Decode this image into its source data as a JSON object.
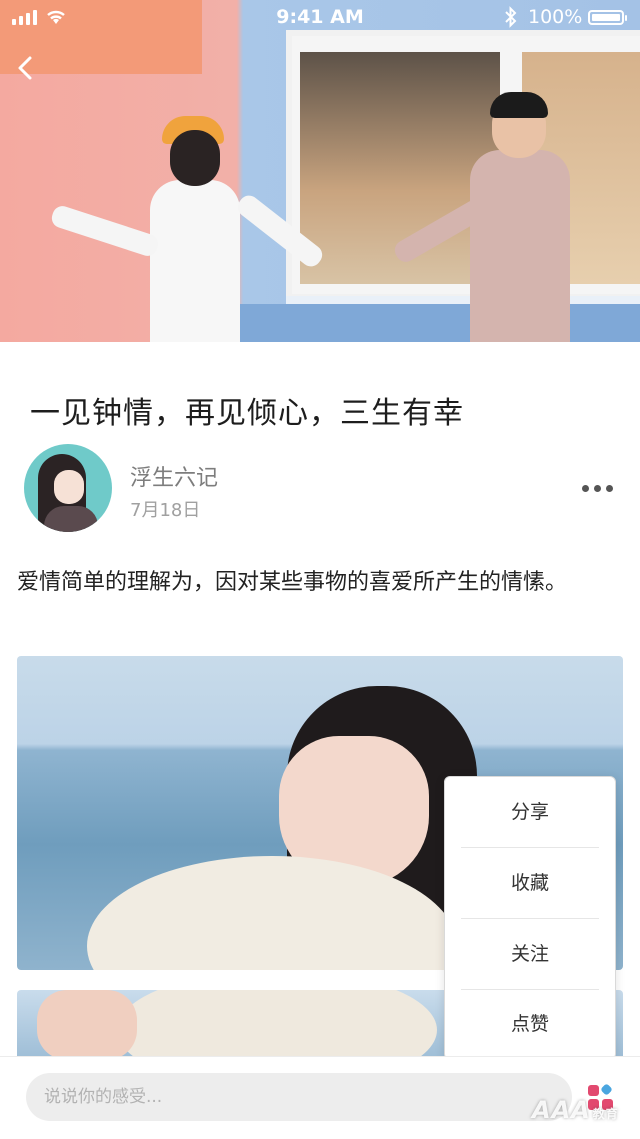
{
  "status_bar": {
    "time": "9:41 AM",
    "battery_percent": "100%",
    "wifi_icon": "wifi-icon",
    "bluetooth_icon": "bluetooth-icon"
  },
  "header": {
    "back_icon": "chevron-left-icon"
  },
  "article": {
    "title": "一见钟情，再见倾心，三生有幸",
    "author": "浮生六记",
    "date": "7月18日",
    "body": "爱情简单的理解为，因对某些事物的喜爱所产生的情愫。"
  },
  "action_menu": {
    "items": [
      {
        "label": "分享"
      },
      {
        "label": "收藏"
      },
      {
        "label": "关注"
      },
      {
        "label": "点赞"
      }
    ]
  },
  "bottom_bar": {
    "comment_placeholder": "说说你的感受...",
    "menu_icon": "grid-menu-icon"
  },
  "watermark": {
    "text": "AAA",
    "sub": "教育"
  },
  "colors": {
    "accent_pink": "#e2496f",
    "accent_blue": "#4aa6e0",
    "hero_orange": "#f39a78"
  }
}
